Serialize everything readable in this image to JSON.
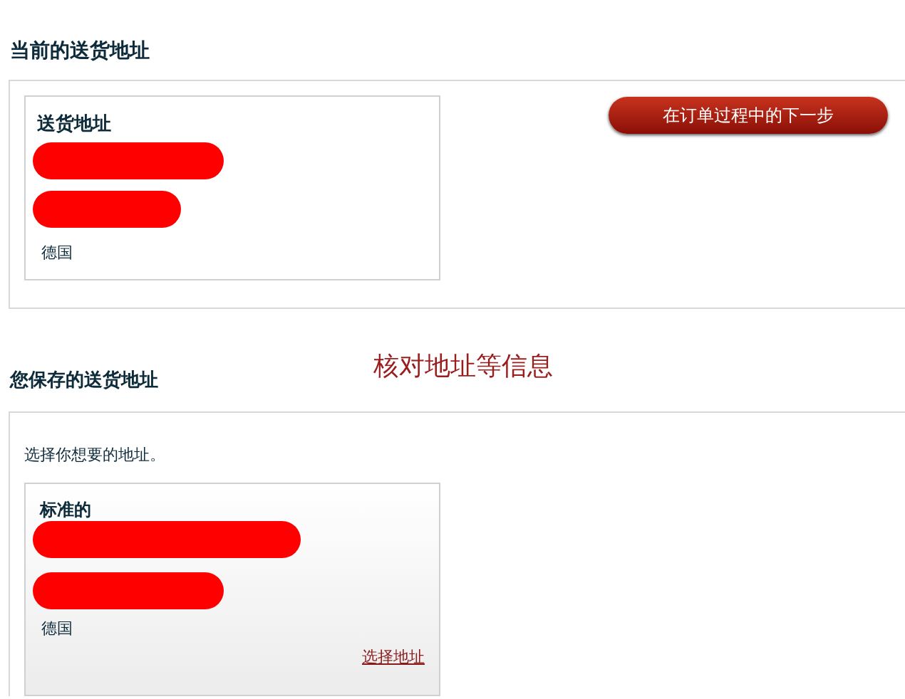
{
  "current_section": {
    "heading": "当前的送货地址",
    "card": {
      "title": "送货地址",
      "country": "德国"
    },
    "next_button": "在订单过程中的下一步"
  },
  "saved_section": {
    "heading": "您保存的送货地址",
    "annotation": "核对地址等信息",
    "instruction": "选择你想要的地址。",
    "card": {
      "title": "标准的",
      "country": "德国",
      "select_link": "选择地址"
    }
  }
}
